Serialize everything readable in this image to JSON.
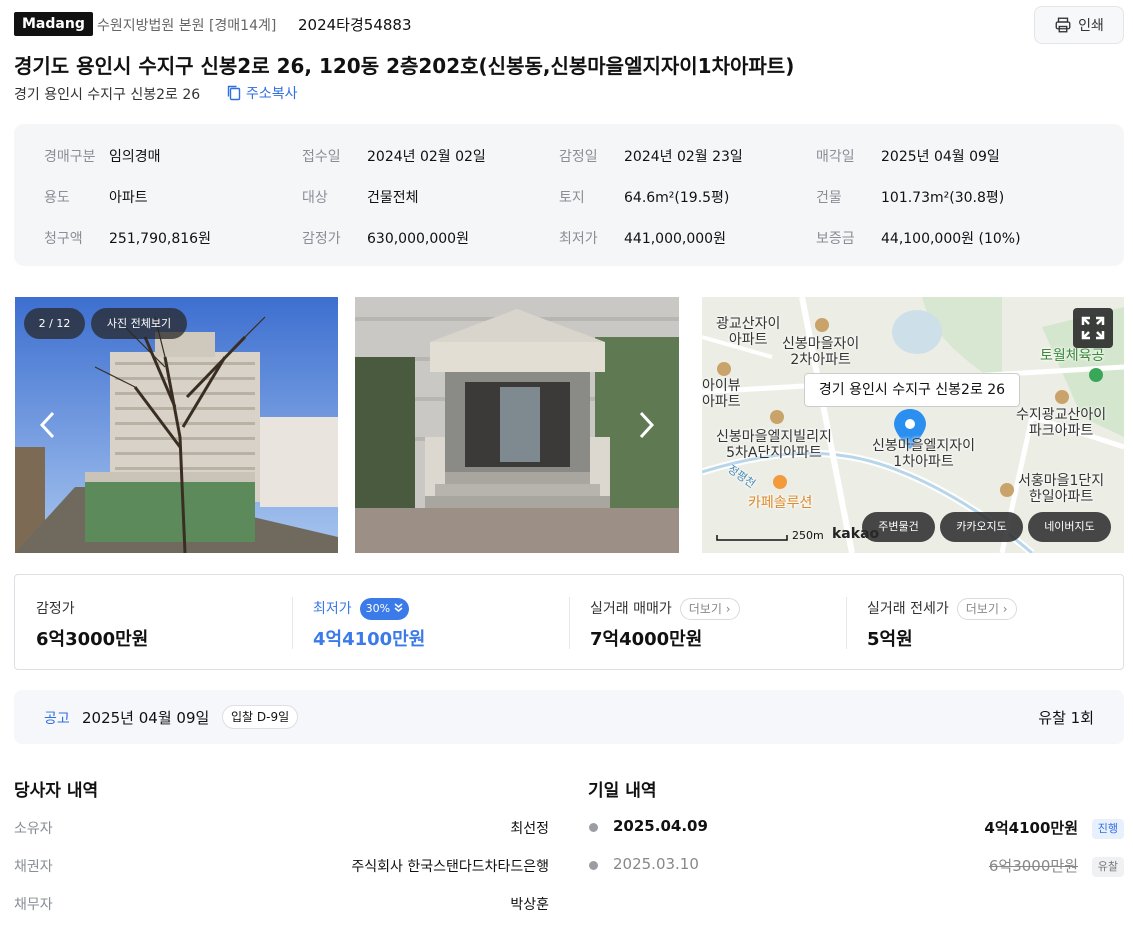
{
  "header": {
    "logo": "Madang",
    "court": "수원지방법원 본원 [경매14계]",
    "case_no": "2024타경54883",
    "print_label": "인쇄",
    "title": "경기도 용인시 수지구 신봉2로 26, 120동 2층202호(신봉동,신봉마을엘지자이1차아파트)",
    "short_address": "경기 용인시 수지구 신봉2로 26",
    "copy_label": "주소복사"
  },
  "info": [
    {
      "label": "경매구분",
      "value": "임의경매"
    },
    {
      "label": "접수일",
      "value": "2024년 02월 02일"
    },
    {
      "label": "감정일",
      "value": "2024년 02월 23일"
    },
    {
      "label": "매각일",
      "value": "2025년 04월 09일"
    },
    {
      "label": "용도",
      "value": "아파트"
    },
    {
      "label": "대상",
      "value": "건물전체"
    },
    {
      "label": "토지",
      "value": "64.6m²(19.5평)"
    },
    {
      "label": "건물",
      "value": "101.73m²(30.8평)"
    },
    {
      "label": "청구액",
      "value": "251,790,816원"
    },
    {
      "label": "감정가",
      "value": "630,000,000원"
    },
    {
      "label": "최저가",
      "value": "441,000,000원"
    },
    {
      "label": "보증금",
      "value": "44,100,000원 (10%)"
    }
  ],
  "photos": {
    "counter": "2 / 12",
    "view_all": "사진 전체보기"
  },
  "map": {
    "tooltip": "경기 용인시 수지구 신봉2로 26",
    "labels": [
      "광교산자이\n아파트",
      "신봉마을자이\n2차아파트",
      "토월체육공",
      "아이뷰\n아파트",
      "수지광교산아이\n파크아파트",
      "신봉마을엘지빌리지\n5차A단지아파트",
      "신봉마을엘지자이\n1차아파트",
      "카페솔루션",
      "서홍마을1단지\n한일아파트",
      "정평천"
    ],
    "scale": "250m",
    "brand": "kakao",
    "buttons": [
      "주변물건",
      "카카오지도",
      "네이버지도"
    ]
  },
  "prices": [
    {
      "label": "감정가",
      "value": "6억3000만원"
    },
    {
      "label": "최저가",
      "badge": "30%",
      "value": "4억4100만원"
    },
    {
      "label": "실거래 매매가",
      "more": "더보기",
      "value": "7억4000만원"
    },
    {
      "label": "실거래 전세가",
      "more": "더보기",
      "value": "5억원"
    }
  ],
  "notice": {
    "label": "공고",
    "date": "2025년 04월 09일",
    "dday": "입찰 D-9일",
    "fail_count": "유찰 1회"
  },
  "parties": {
    "title": "당사자 내역",
    "rows": [
      {
        "label": "소유자",
        "value": "최선정"
      },
      {
        "label": "채권자",
        "value": "주식회사 한국스탠다드차타드은행"
      },
      {
        "label": "채무자",
        "value": "박상훈"
      }
    ]
  },
  "dates": {
    "title": "기일 내역",
    "rows": [
      {
        "date": "2025.04.09",
        "price": "4억4100만원",
        "status": "진행"
      },
      {
        "date": "2025.03.10",
        "price": "6억3000만원",
        "status": "유찰"
      }
    ]
  },
  "colors": {
    "accent": "#3b7be9",
    "link": "#2f6fe0",
    "panel": "#f5f6f8",
    "map_pin": "#2b8ff0"
  }
}
